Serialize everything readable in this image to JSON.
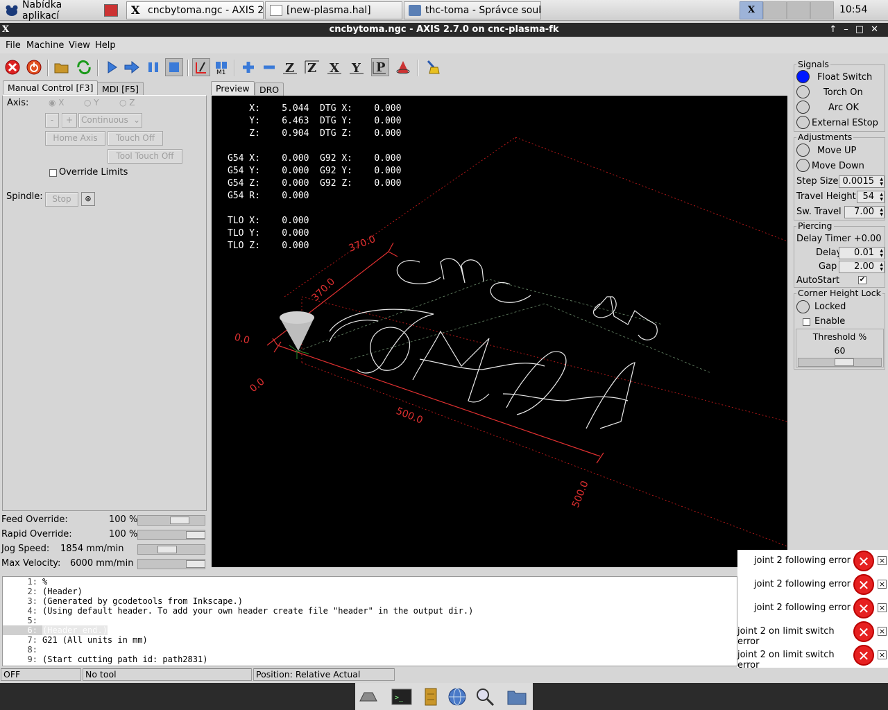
{
  "taskbar": {
    "app_menu": "Nabídka aplikací",
    "windows": [
      "cncbytoma.ngc - AXIS 2....",
      "[new-plasma.hal]",
      "thc-toma - Správce soub..."
    ],
    "clock": "10:54"
  },
  "window_title": "cncbytoma.ngc - AXIS 2.7.0 on cnc-plasma-fk",
  "menu": [
    "File",
    "Machine",
    "View",
    "Help"
  ],
  "left_tabs": [
    "Manual Control [F3]",
    "MDI [F5]"
  ],
  "manual": {
    "axis_label": "Axis:",
    "axes": [
      "X",
      "Y",
      "Z"
    ],
    "minus": "-",
    "plus": "+",
    "jog_mode": "Continuous",
    "home_axis": "Home Axis",
    "touch_off": "Touch Off",
    "tool_touch_off": "Tool Touch Off",
    "override_limits": "Override Limits",
    "spindle_label": "Spindle:",
    "spindle_stop": "Stop"
  },
  "view_tabs": [
    "Preview",
    "DRO"
  ],
  "dro_lines": [
    "    X:    5.044  DTG X:    0.000",
    "    Y:    6.463  DTG Y:    0.000",
    "    Z:    0.904  DTG Z:    0.000",
    "",
    "G54 X:    0.000  G92 X:    0.000",
    "G54 Y:    0.000  G92 Y:    0.000",
    "G54 Z:    0.000  G92 Z:    0.000",
    "G54 R:    0.000",
    "",
    "TLO X:    0.000",
    "TLO Y:    0.000",
    "TLO Z:    0.000"
  ],
  "preview_labels": {
    "x_top": "370.0",
    "x_mid": "370.0",
    "zero_a": "0.0",
    "zero_b": "0.0",
    "bottom": "500.0",
    "right": "500.0"
  },
  "overrides": [
    {
      "label": "Feed Override:",
      "value": "100 %",
      "level": 0.62
    },
    {
      "label": "Rapid Override:",
      "value": "100 %",
      "level": 0.86
    },
    {
      "label": "Jog Speed:",
      "value": "1854 mm/min",
      "level": 0.44
    },
    {
      "label": "Max Velocity:",
      "value": "6000 mm/min",
      "level": 0.86
    }
  ],
  "gcode": [
    {
      "n": "1:",
      "text": "%"
    },
    {
      "n": "2:",
      "text": "(Header)"
    },
    {
      "n": "3:",
      "text": "(Generated by gcodetools from Inkscape.)"
    },
    {
      "n": "4:",
      "text": "(Using default header. To add your own header create file \"header\" in the output dir.)"
    },
    {
      "n": "5:",
      "text": ""
    },
    {
      "n": "6:",
      "text": "(Header end.)"
    },
    {
      "n": "7:",
      "text": "G21 (All units in mm)"
    },
    {
      "n": "8:",
      "text": ""
    },
    {
      "n": "9:",
      "text": "(Start cutting path id: path2831)"
    }
  ],
  "status": {
    "state": "OFF",
    "tool": "No tool",
    "position": "Position: Relative Actual"
  },
  "signals": {
    "title": "Signals",
    "items": [
      {
        "label": "Float Switch",
        "color": "#0018ff"
      },
      {
        "label": "Torch On",
        "color": "#d0d0d0"
      },
      {
        "label": "Arc OK",
        "color": "#d0d0d0"
      },
      {
        "label": "External EStop",
        "color": "#d0d0d0"
      }
    ]
  },
  "adjustments": {
    "title": "Adjustments",
    "move_up": "Move UP",
    "move_down": "Move Down",
    "step_size_label": "Step Size",
    "step_size": "0.0015",
    "travel_height_label": "Travel Height",
    "travel_height": "54",
    "sw_travel_label": "Sw. Travel",
    "sw_travel": "7.00"
  },
  "piercing": {
    "title": "Piercing",
    "delay_timer": "Delay Timer +0.00",
    "delay_label": "Delay",
    "delay": "0.01",
    "gap_label": "Gap",
    "gap": "2.00",
    "autostart_label": "AutoStart",
    "autostart_check": "✔"
  },
  "corner": {
    "title": "Corner Height Lock",
    "locked": "Locked",
    "enable": "Enable",
    "threshold_label": "Threshold %",
    "threshold": "60"
  },
  "errors": [
    "joint 2 following error",
    "joint 2 following error",
    "joint 2 following error",
    "joint 2 on limit switch error",
    "joint 2 on limit switch error"
  ],
  "error_icon": "✕",
  "close_icon": "×"
}
